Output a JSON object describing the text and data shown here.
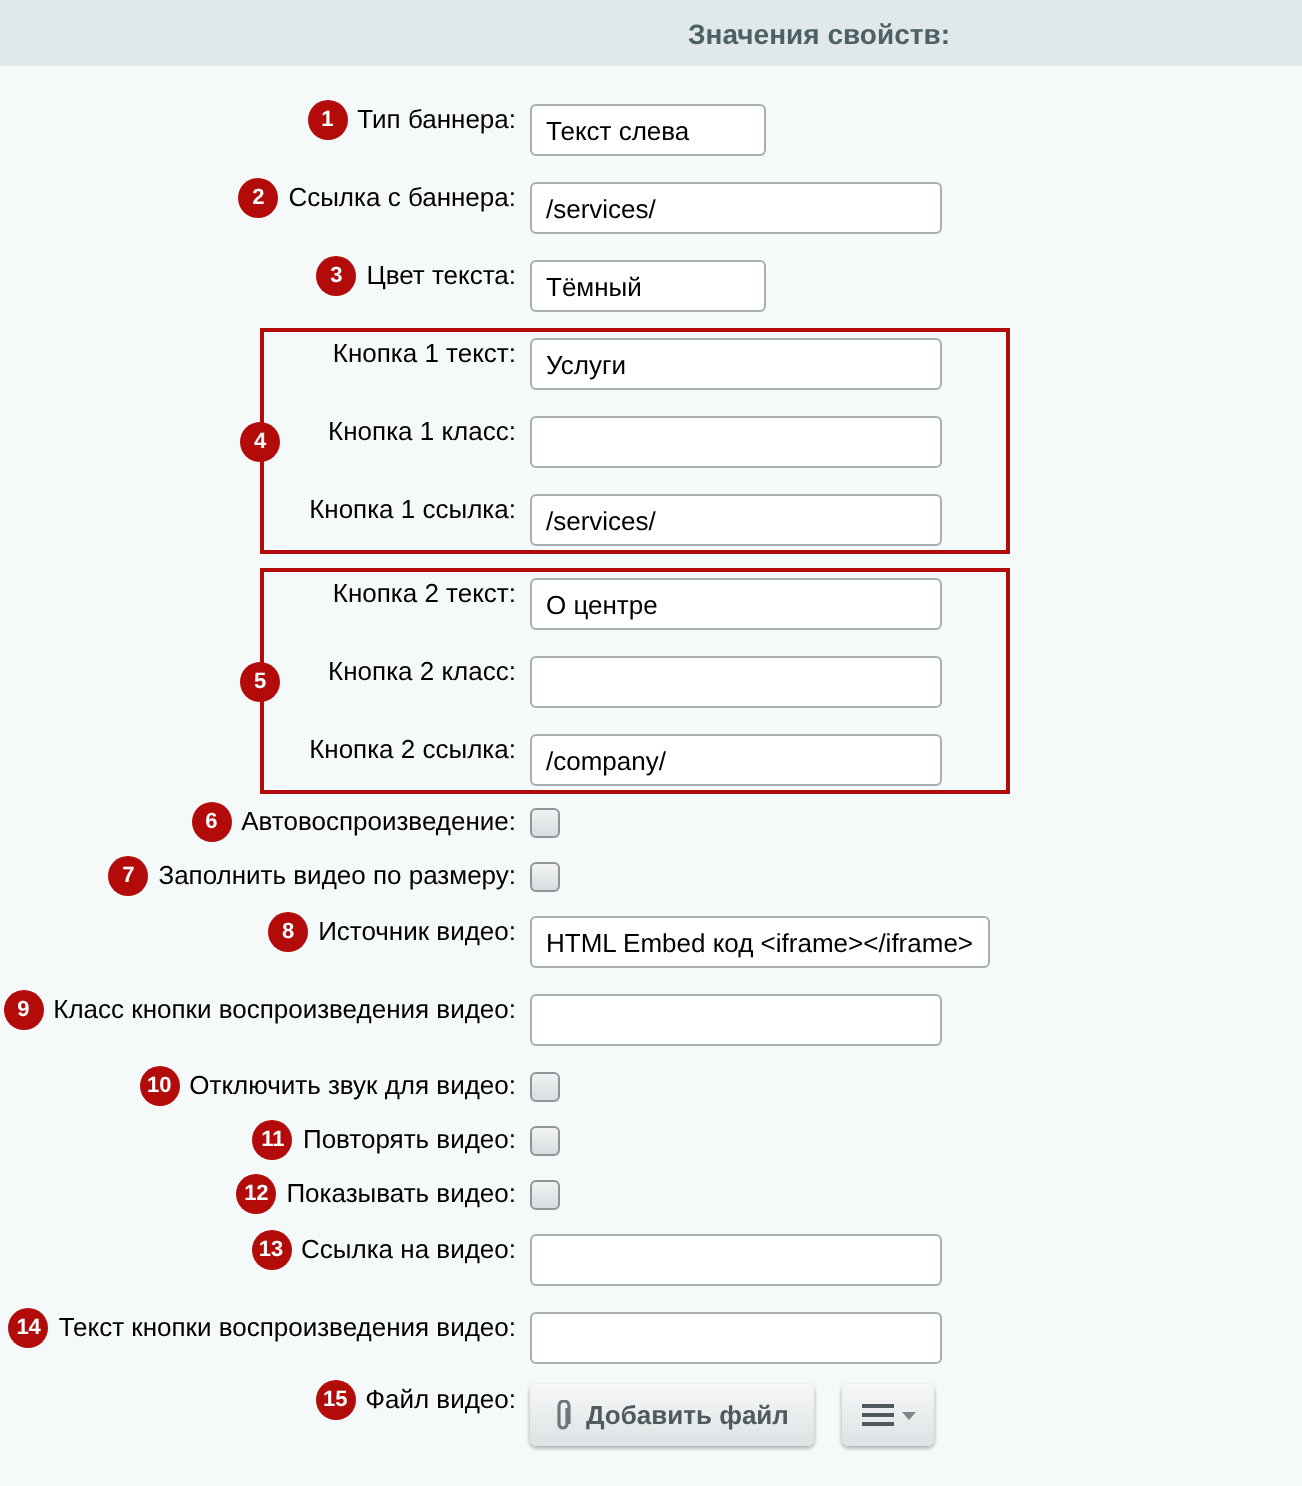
{
  "header": {
    "title": "Значения свойств:"
  },
  "properties": [
    {
      "kind": "short-field",
      "number": "1",
      "label": "Тип баннера:",
      "value": "Текст слева"
    },
    {
      "kind": "field",
      "number": "2",
      "label": "Ссылка с баннера:",
      "value": "/services/"
    },
    {
      "kind": "short-field",
      "number": "3",
      "label": "Цвет текста:",
      "value": "Тёмный"
    },
    {
      "kind": "group",
      "number": "4",
      "fields": [
        {
          "kind": "field",
          "label": "Кнопка 1 текст:",
          "value": "Услуги"
        },
        {
          "kind": "field",
          "label": "Кнопка 1 класс:"
        },
        {
          "kind": "field",
          "label": "Кнопка 1 ссылка:",
          "value": "/services/"
        }
      ]
    },
    {
      "kind": "group",
      "number": "5",
      "fields": [
        {
          "kind": "field",
          "label": "Кнопка 2 текст:",
          "value": "О центре"
        },
        {
          "kind": "field",
          "label": "Кнопка 2 класс:"
        },
        {
          "kind": "field",
          "label": "Кнопка 2 ссылка:",
          "value": "/company/"
        }
      ]
    },
    {
      "kind": "checkbox",
      "number": "6",
      "label": "Автовоспроизведение:",
      "checked": false
    },
    {
      "kind": "checkbox",
      "number": "7",
      "label": "Заполнить видео по размеру:",
      "checked": false
    },
    {
      "kind": "wide-field",
      "number": "8",
      "label": "Источник видео:",
      "value": "HTML Embed код <iframe></iframe>"
    },
    {
      "kind": "field",
      "number": "9",
      "label": "Класс кнопки воспроизведения видео:"
    },
    {
      "kind": "checkbox",
      "number": "10",
      "label": "Отключить звук для видео:",
      "checked": false
    },
    {
      "kind": "checkbox",
      "number": "11",
      "label": "Повторять видео:",
      "checked": false
    },
    {
      "kind": "checkbox",
      "number": "12",
      "label": "Показывать видео:",
      "checked": false
    },
    {
      "kind": "field",
      "number": "13",
      "label": "Ссылка на видео:"
    },
    {
      "kind": "field",
      "number": "14",
      "label": "Текст кнопки воспроизведения видео:"
    },
    {
      "kind": "file",
      "number": "15",
      "label": "Файл видео:",
      "button": "Добавить файл"
    }
  ]
}
